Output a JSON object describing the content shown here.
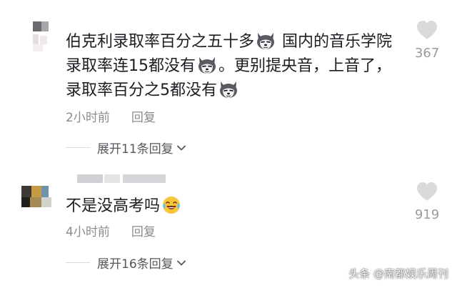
{
  "comments": [
    {
      "segments": [
        "伯克利录取率百分之五十多",
        " 国内的音乐学院录取率连15都没有",
        "。更别提央音，上音了，录取率百分之5都没有",
        ""
      ],
      "time": "2小时前",
      "reply_label": "回复",
      "expand_label": "展开11条回复",
      "likes": "367",
      "emoji": "husky-dog-emoji"
    },
    {
      "text": "不是没高考吗",
      "time": "4小时前",
      "reply_label": "回复",
      "expand_label": "展开16条回复",
      "likes": "919",
      "emoji": "laughing-crying-emoji"
    }
  ],
  "watermark": "头条 @南都娱乐周刊",
  "colors": {
    "text": "#1c1c22",
    "meta": "#8a8b91",
    "heart": "#d9d9dc"
  }
}
